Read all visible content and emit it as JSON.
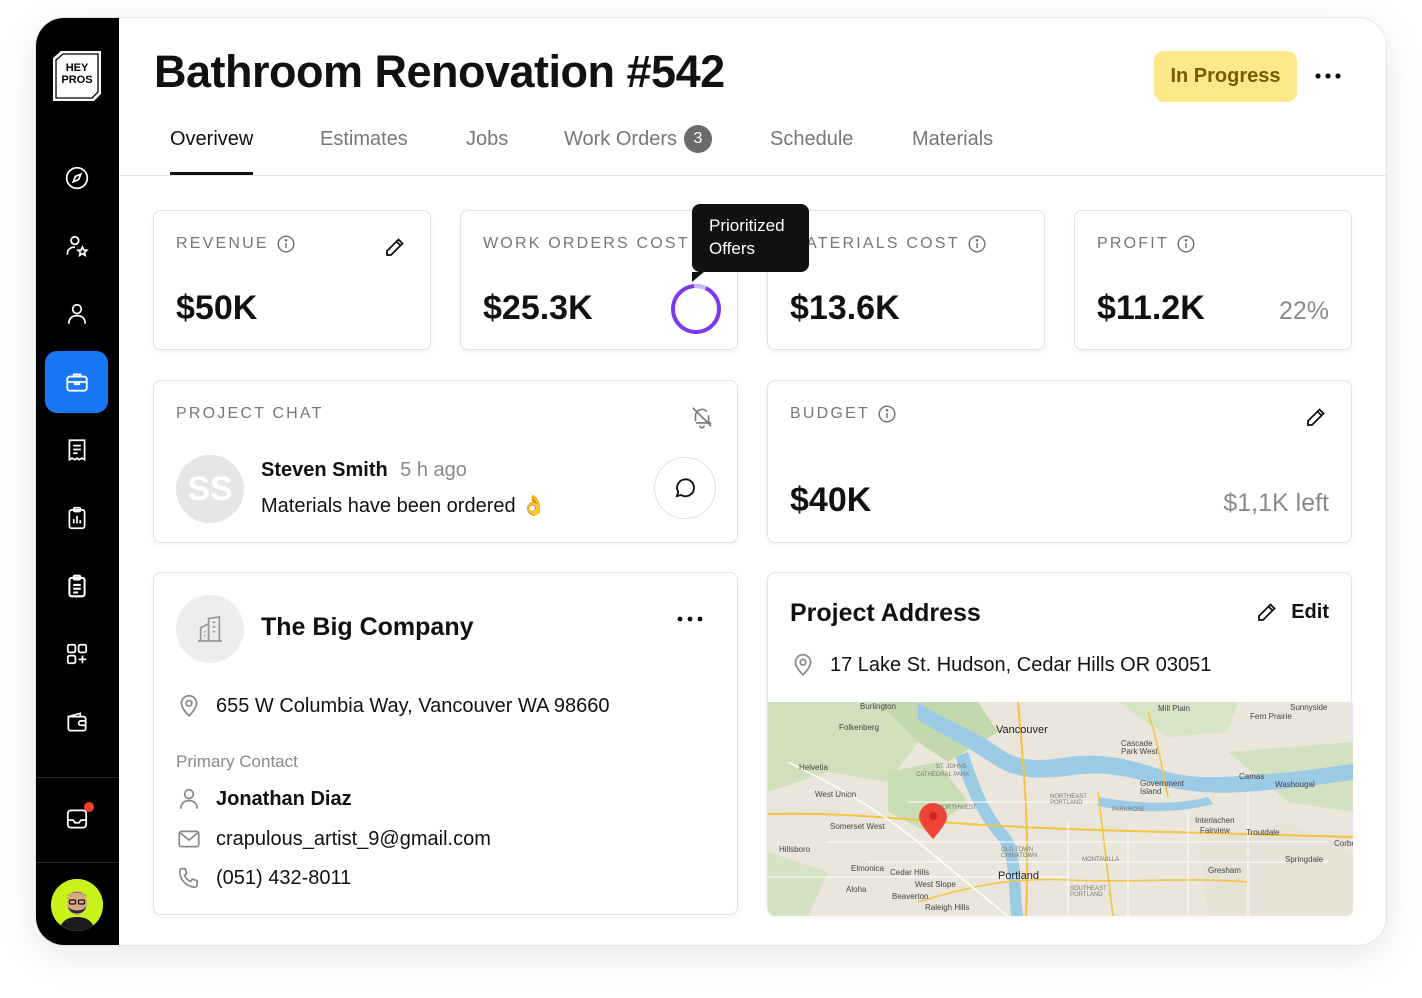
{
  "app": {
    "logo_text": [
      "HEY",
      "PROS"
    ]
  },
  "header": {
    "title": "Bathroom Renovation #542",
    "status": "In Progress",
    "more_label": "•••"
  },
  "tabs": [
    {
      "label": "Overivew",
      "active": true
    },
    {
      "label": "Estimates"
    },
    {
      "label": "Jobs"
    },
    {
      "label": "Work Orders",
      "badge": "3"
    },
    {
      "label": "Schedule"
    },
    {
      "label": "Materials"
    }
  ],
  "sidebar": {
    "items": [
      {
        "icon": "compass-icon"
      },
      {
        "icon": "user-star-icon"
      },
      {
        "icon": "user-icon"
      },
      {
        "icon": "briefcase-icon",
        "active": true
      },
      {
        "icon": "receipt-icon"
      },
      {
        "icon": "clipboard-chart-icon"
      },
      {
        "icon": "clipboard-list-icon"
      },
      {
        "icon": "grid-add-icon"
      },
      {
        "icon": "wallet-icon"
      },
      {
        "icon": "inbox-icon",
        "notification": true
      }
    ]
  },
  "metrics": {
    "revenue": {
      "label": "REVENUE",
      "value": "$50K"
    },
    "work_orders_cost": {
      "label": "WORK ORDERS COST",
      "value": "$25.3K"
    },
    "materials_cost": {
      "label": "ATERIALS COST",
      "value": "$13.6K"
    },
    "profit": {
      "label": "PROFIT",
      "value": "$11.2K",
      "percent": "22%"
    }
  },
  "tooltip": {
    "line1": "Prioritized",
    "line2": "Offers"
  },
  "chat": {
    "label": "PROJECT CHAT",
    "avatar_initials": "SS",
    "sender": "Steven Smith",
    "time": "5 h ago",
    "message": "Materials have been ordered 👌"
  },
  "budget": {
    "label": "BUDGET",
    "value": "$40K",
    "left": "$1,1K left"
  },
  "company": {
    "name": "The Big Company",
    "address": "655 W Columbia Way, Vancouver WA 98660",
    "primary_contact_label": "Primary Contact",
    "contact_name": "Jonathan Diaz",
    "email": "crapulous_artist_9@gmail.com",
    "phone": "(051) 432-8011",
    "more_label": "•••"
  },
  "project_address": {
    "title": "Project Address",
    "edit_label": "Edit",
    "address": "17 Lake St. Hudson, Cedar Hills OR 03051",
    "map_labels": {
      "vancouver": "Vancouver",
      "portland": "Portland",
      "hillsboro": "Hillsboro",
      "gresham": "Gresham",
      "beaverton": "Beaverton",
      "burlington": "Burlington",
      "folkenberg": "Folkenberg",
      "helvetia": "Helvetia",
      "west_union": "West Union",
      "somerset_west": "Somerset West",
      "elmonica": "Elmonica",
      "aloha": "Aloha",
      "cedar_hills": "Cedar Hills",
      "west_slope": "West Slope",
      "raleigh_hills": "Raleigh Hills",
      "cascade_park": "Cascade Park West",
      "government_island": "Government Island",
      "camas": "Camas",
      "washougal": "Washougal",
      "troutdale": "Troutdale",
      "fairview": "Fairview",
      "springdale": "Springdale",
      "mill_plain": "Mill Plain",
      "fern_prairie": "Fern Prairie",
      "sunnyside": "Sunnyside",
      "interlachen": "Interlachen",
      "corbett": "Corbe",
      "st_johns": "ST. JOHNS",
      "cathedral_park": "CATHEDRAL PARK",
      "northeast_portland": "NORTHEAST PORTLAND",
      "parkrose": "PARKROSE",
      "montavilla": "MONTAVILLA",
      "southeast_portland": "SOUTHEAST PORTLAND",
      "old_town": "OLD TOWN CHINATOWN",
      "northwest": "NORTHWEST"
    }
  },
  "colors": {
    "accent": "#1877f2",
    "status_bg": "#fde98a",
    "status_text": "#7a5a00",
    "ring": "#7c3aed",
    "pin": "#f04438",
    "notification": "#ff3b30"
  }
}
